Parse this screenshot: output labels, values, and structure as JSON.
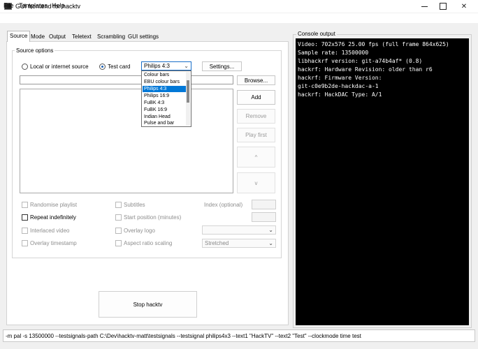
{
  "window": {
    "title": "GUI frontend for hacktv",
    "close_symbol": "✕"
  },
  "menu": [
    "File",
    "Templates",
    "Help"
  ],
  "tabs": [
    "Source",
    "Mode",
    "Output",
    "Teletext",
    "Scrambling",
    "GUI settings"
  ],
  "active_tab": "Source",
  "source_options": {
    "group_title": "Source options",
    "radio_local": "Local or internet source",
    "radio_test": "Test card",
    "selected_radio": "Test card",
    "testcard_value": "Philips 4:3",
    "dropdown_arrow": "⌄",
    "settings_button": "Settings...",
    "browse_button": "Browse...",
    "path_value": "",
    "playlist_buttons": {
      "add": "Add",
      "remove": "Remove",
      "play_first": "Play first",
      "up": "^",
      "down": "v"
    }
  },
  "testcard_options": [
    "Colour bars",
    "EBU colour bars",
    "Philips 4:3",
    "Philips 16:9",
    "FuBK 4:3",
    "FuBK 16:9",
    "Indian Head",
    "Pulse and bar"
  ],
  "testcard_selected_index": 2,
  "checkboxes_left": [
    {
      "label": "Randomise playlist",
      "enabled": false,
      "checked": false
    },
    {
      "label": "Repeat indefinitely",
      "enabled": true,
      "checked": false
    },
    {
      "label": "Interlaced video",
      "enabled": false,
      "checked": false
    },
    {
      "label": "Overlay timestamp",
      "enabled": false,
      "checked": false
    }
  ],
  "checkboxes_right": [
    {
      "label": "Subtitles",
      "enabled": false,
      "checked": false
    },
    {
      "label": "Start position (minutes)",
      "enabled": false,
      "checked": false
    },
    {
      "label": "Overlay logo",
      "enabled": false,
      "checked": false
    },
    {
      "label": "Aspect ratio scaling",
      "enabled": false,
      "checked": false
    }
  ],
  "index_label": "Index (optional)",
  "aspect_scaling_value": "Stretched",
  "stop_button": "Stop hacktv",
  "console": {
    "title": "Console output",
    "lines": [
      "Video: 702x576 25.00 fps (full frame 864x625)",
      "Sample rate: 13500000",
      "libhackrf version: git-a74b4af* (0.8)",
      "hackrf: Hardware Revision: older than r6",
      "hackrf: Firmware Version:",
      "git-c0e9b2de-hackdac-a-1",
      "hackrf: HackDAC Type: A/1"
    ]
  },
  "status_command": "-m pal -s 13500000 --testsignals-path C:\\Dev\\hacktv-matt\\testsignals --testsignal philips4x3 --text1 \"HackTV\" --text2 \"Test\" --clockmode time test"
}
